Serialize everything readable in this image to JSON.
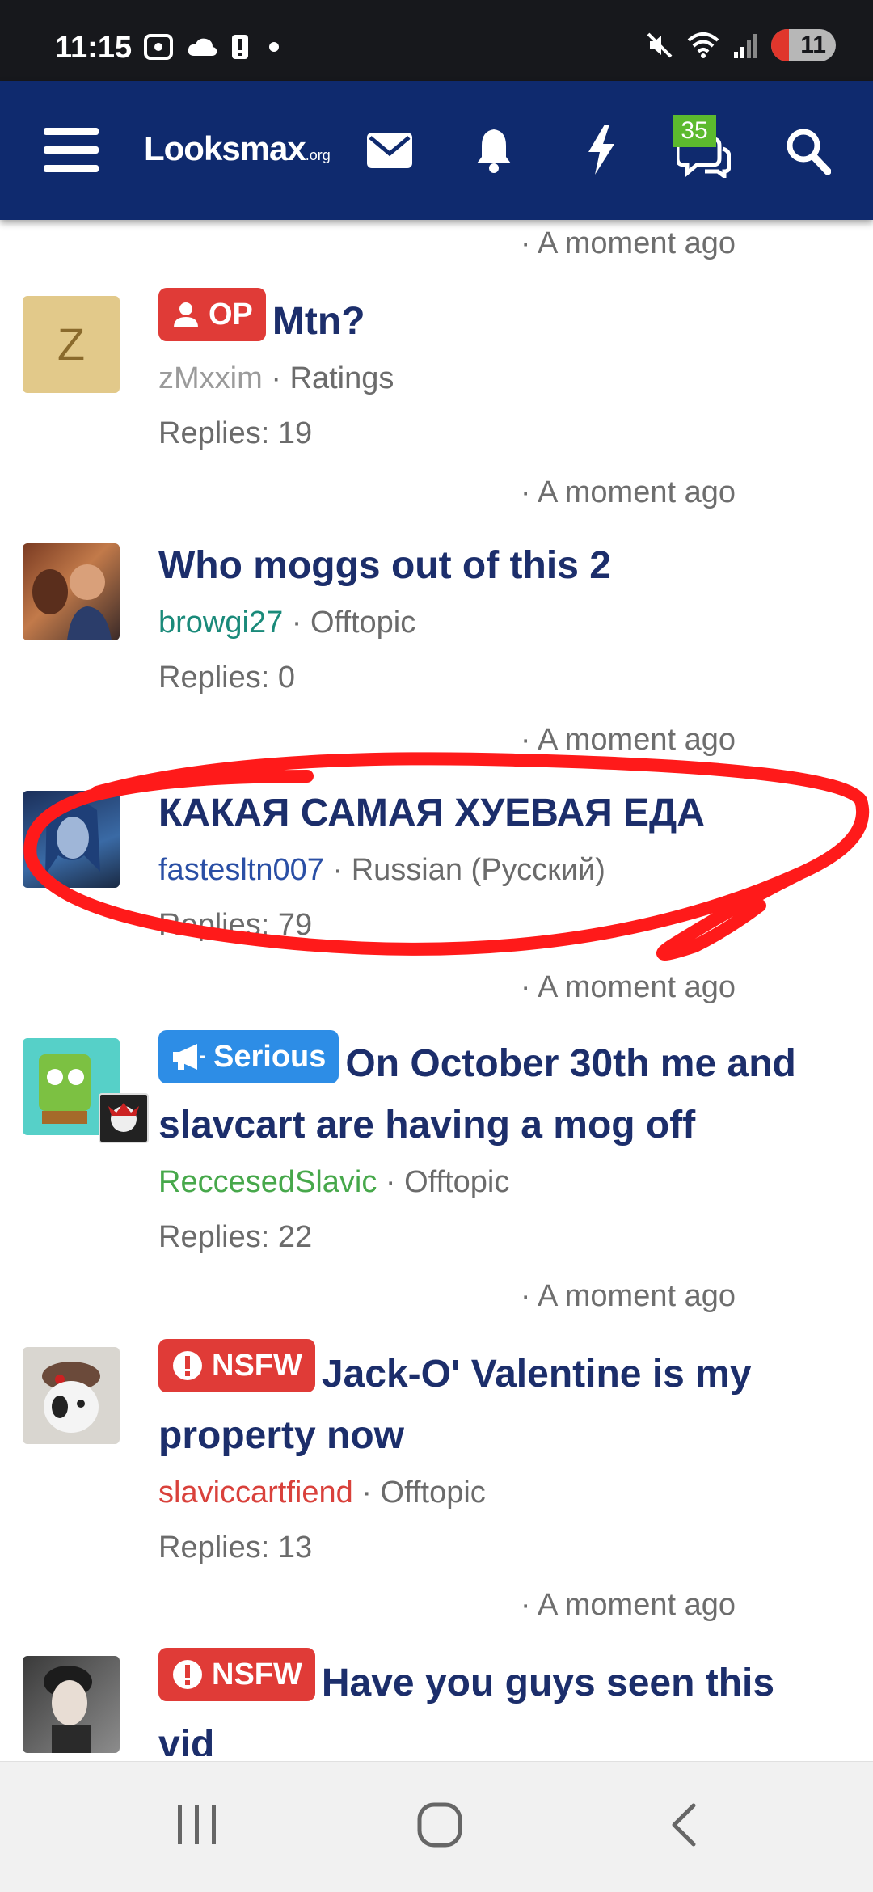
{
  "status_bar": {
    "time": "11:15",
    "battery": "11"
  },
  "app_bar": {
    "logo_main": "Looksmax",
    "logo_suffix": ".org",
    "conversations_count": "35",
    "colors": {
      "bar": "#0f2a6e",
      "badge": "#5cba2e"
    }
  },
  "feed": {
    "top_time": "· A moment ago",
    "threads": [
      {
        "avatar_letter": "Z",
        "prefix": "OP",
        "title": "Mtn?",
        "author": "zMxxim",
        "forum": "· Ratings",
        "replies": "Replies: 19",
        "time": "· A moment ago"
      },
      {
        "title": "Who moggs out of this 2",
        "author": "browgi27",
        "forum": "· Offtopic",
        "replies": "Replies: 0",
        "time": "· A moment ago"
      },
      {
        "title": "КАКАЯ САМАЯ ХУЕВАЯ ЕДА",
        "author": "fastesltn007",
        "forum": "· Russian (Русский)",
        "replies": "Replies: 79",
        "time": "· A moment ago"
      },
      {
        "prefix": "Serious",
        "title": "On October 30th me and slavcart are having a mog off",
        "author": "ReccesedSlavic",
        "forum": "· Offtopic",
        "replies": "Replies: 22",
        "time": "· A moment ago"
      },
      {
        "prefix": "NSFW",
        "title": "Jack-O' Valentine is my property now",
        "author": "slaviccartfiend",
        "forum": "· Offtopic",
        "replies": "Replies: 13",
        "time": "· A moment ago"
      },
      {
        "prefix": "NSFW",
        "title": "Have you guys seen this vid"
      }
    ]
  }
}
